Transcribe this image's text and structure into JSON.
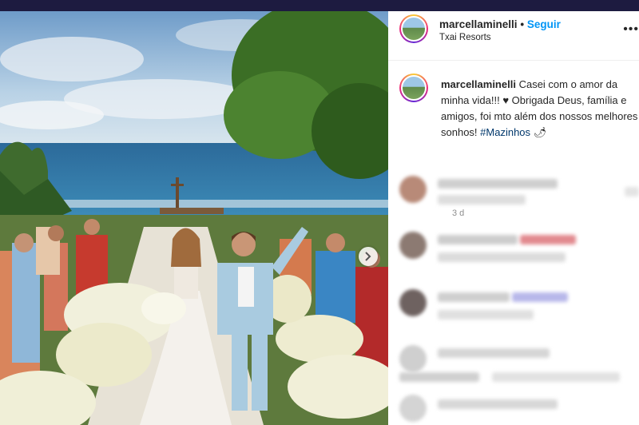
{
  "post": {
    "username": "marcellaminelli",
    "separator": "•",
    "follow_label": "Seguir",
    "location": "Txai Resorts",
    "more_icon": "ellipsis-icon",
    "caption": {
      "username": "marcellaminelli",
      "text": "Casei com o amor da minha vida!!! ♥ Obrigada Deus, família e amigos, foi mto além dos nossos melhores sonhos!",
      "hashtag": "#Mazinhos",
      "emoji": "🌶"
    },
    "time_ago": "3 d",
    "next_icon": "chevron-right-icon"
  },
  "colors": {
    "link_blue": "#0095f6",
    "hashtag_blue": "#00376b",
    "text": "#262626",
    "muted": "#8e8e8e"
  }
}
